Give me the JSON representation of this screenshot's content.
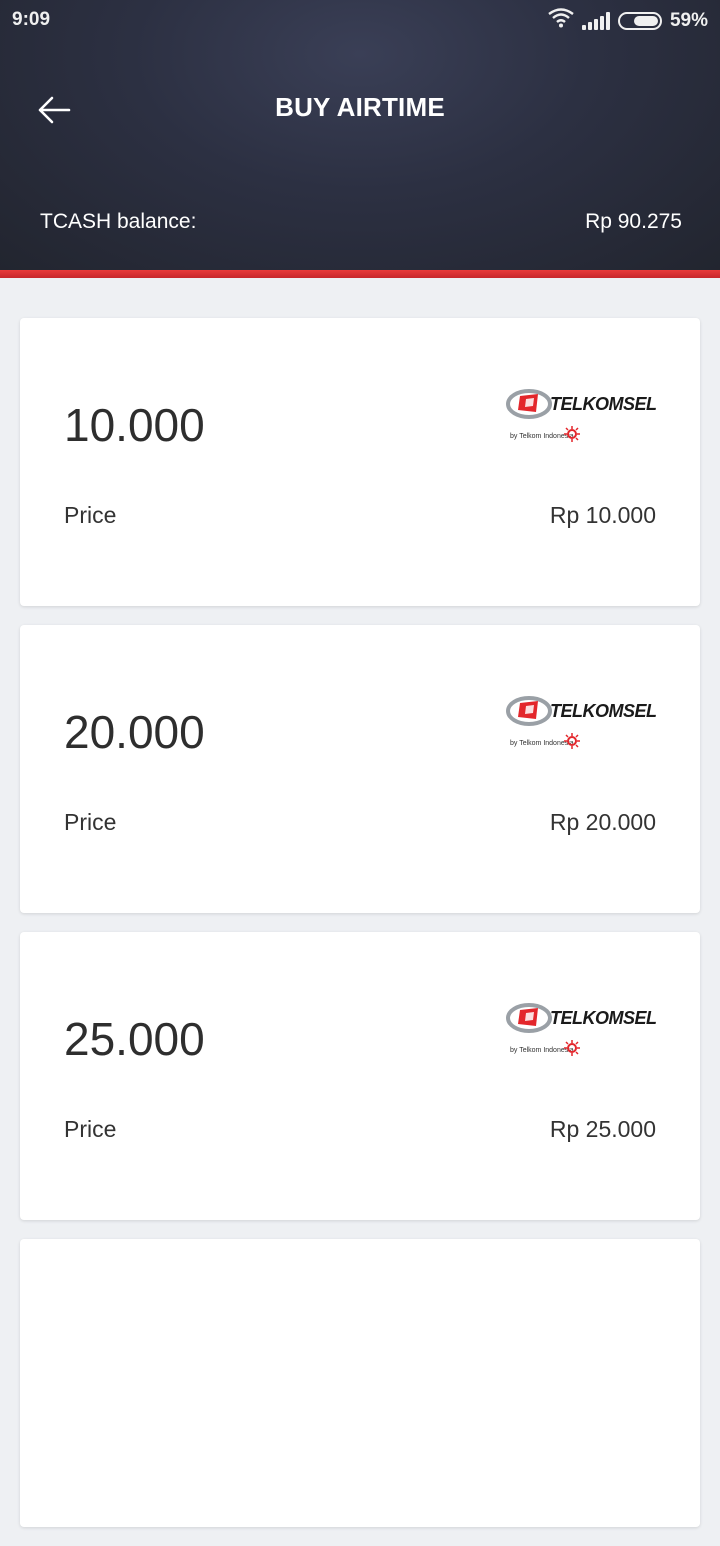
{
  "status_bar": {
    "time": "9:09",
    "battery": "59%"
  },
  "header": {
    "title": "BUY AIRTIME",
    "balance_label": "TCASH balance:",
    "balance_value": "Rp 90.275"
  },
  "colors": {
    "header_bg": "#2c3042",
    "accent_red": "#e3262b",
    "page_bg": "#eef0f3"
  },
  "cards": [
    {
      "amount": "10.000",
      "price_label": "Price",
      "price": "Rp 10.000",
      "brand": "TELKOMSEL",
      "tagline": "by Telkom Indonesia"
    },
    {
      "amount": "20.000",
      "price_label": "Price",
      "price": "Rp 20.000",
      "brand": "TELKOMSEL",
      "tagline": "by Telkom Indonesia"
    },
    {
      "amount": "25.000",
      "price_label": "Price",
      "price": "Rp 25.000",
      "brand": "TELKOMSEL",
      "tagline": "by Telkom Indonesia"
    }
  ]
}
